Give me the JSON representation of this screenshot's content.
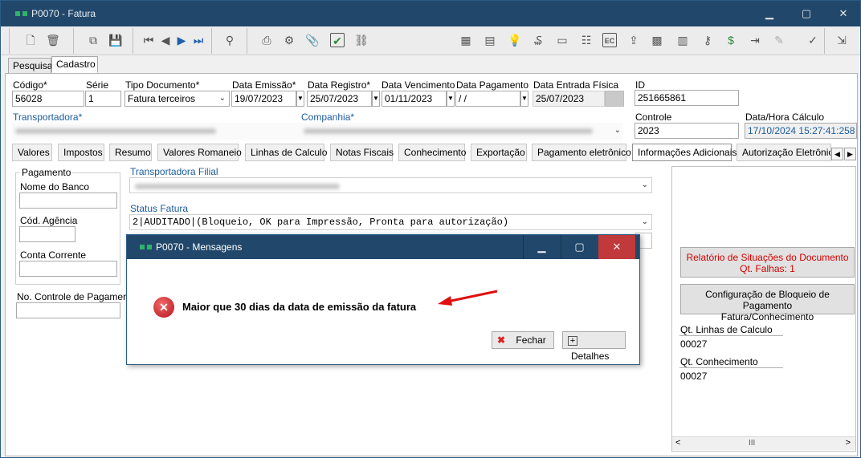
{
  "window": {
    "title": "P0070 - Fatura",
    "minimize": "▁",
    "maximize": "▢",
    "close": "✕"
  },
  "toolbar": {
    "icons": [
      "new-document-icon",
      "delete-icon",
      "copy-icon",
      "save-icon",
      "first-record-icon",
      "previous-record-icon",
      "next-record-icon",
      "last-record-icon",
      "binoculars-icon",
      "print-icon",
      "settings-icon",
      "attach-icon",
      "check-icon",
      "link-icon",
      "calculator-icon",
      "table-icon",
      "lightbulb-icon",
      "payment-icon",
      "card-icon",
      "form-icon",
      "ec-icon",
      "export-icon",
      "spreadsheet-add-icon",
      "calculator-grid-icon",
      "key-icon",
      "document-dollar-icon",
      "document-forward-icon",
      "signature-icon",
      "approve-icon",
      "exit-icon"
    ],
    "ec_label": "EC"
  },
  "main_tabs": [
    "Pesquisa",
    "Cadastro"
  ],
  "form": {
    "codigo_label": "Código*",
    "codigo": "56028",
    "serie_label": "Série",
    "serie": "1",
    "tipo_label": "Tipo Documento*",
    "tipo": "Fatura terceiros",
    "emissao_label": "Data Emissão*",
    "emissao": "19/07/2023",
    "registro_label": "Data Registro*",
    "registro": "25/07/2023",
    "vencimento_label": "Data Vencimento",
    "vencimento": "01/11/2023",
    "pagamento_label": "Data Pagamento",
    "pagamento": " / /",
    "entrada_label": "Data Entrada Física",
    "entrada": "25/07/2023",
    "id_label": "ID",
    "id": "251665861",
    "transportadora_label": "Transportadora*",
    "companhia_label": "Companhia*",
    "controle_label": "Controle",
    "controle": "2023",
    "calculo_label": "Data/Hora Cálculo",
    "calculo": "17/10/2024 15:27:41:258"
  },
  "sub_tabs": [
    "Valores",
    "Impostos",
    "Resumo",
    "Valores Romaneio",
    "Linhas de Calculo",
    "Notas Fiscais",
    "Conhecimento",
    "Exportação",
    "Pagamento eletrônico",
    "Informações Adicionais",
    "Autorização Eletrônica"
  ],
  "info": {
    "pagamento_group": "Pagamento",
    "nome_banco": "Nome do Banco",
    "cod_agencia": "Cód. Agência",
    "conta_corrente": "Conta Corrente",
    "no_controle": "No. Controle de Pagamento",
    "transportadora_filial": "Transportadora Filial",
    "status_label": "Status Fatura",
    "status_value": "2|AUDITADO|(Bloqueio, OK para Impressão, Pronta para autorização)"
  },
  "side": {
    "relatorio_line1": "Relatório de Situações do Documento",
    "relatorio_line2": "Qt. Falhas: 1",
    "config_line1": "Configuração de Bloqueio de Pagamento",
    "config_line2": "Fatura/Conhecimento",
    "qt_linhas_label": "Qt. Linhas de Calculo",
    "qt_linhas": "00027",
    "qt_conhecimento_label": "Qt. Conhecimento",
    "qt_conhecimento": "00027",
    "scroll_grip": "III"
  },
  "dialog": {
    "title": "P0070 - Mensagens",
    "message": "Maior que 30 dias da data de emissão da fatura",
    "fechar": "Fechar",
    "detalhes": "Detalhes"
  },
  "colors": {
    "titlebar": "#21486b",
    "error": "#c0141e",
    "link_blue": "#1c5c9c",
    "alert_red": "#d40000"
  }
}
